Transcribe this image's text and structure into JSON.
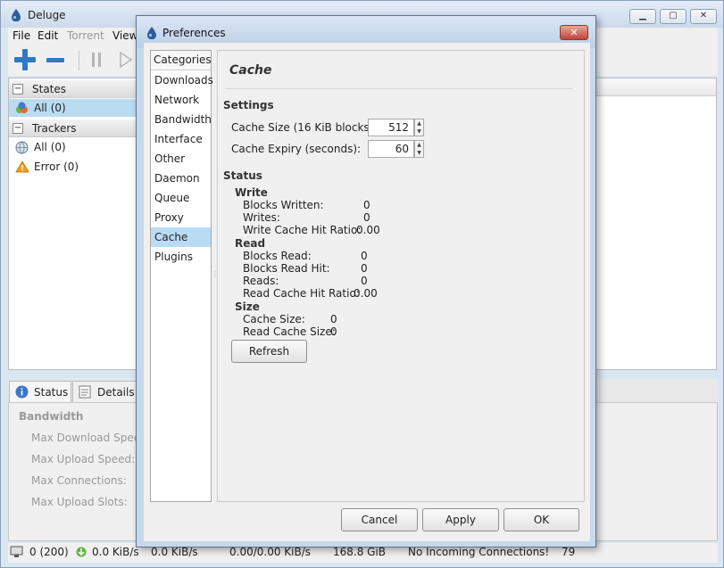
{
  "main": {
    "title": "Deluge",
    "menu": [
      "File",
      "Edit",
      "Torrent",
      "View"
    ],
    "sidebar": {
      "states_header": "States",
      "states_all": "All (0)",
      "trackers_header": "Trackers",
      "trackers_all": "All (0)",
      "trackers_error": "Error (0)"
    },
    "tabs": {
      "status": "Status",
      "details": "Details"
    },
    "bandwidth": {
      "header": "Bandwidth",
      "max_download": "Max Download Speed",
      "max_upload": "Max Upload Speed:",
      "max_connections": "Max Connections:",
      "max_upload_slots": "Max Upload Slots:"
    },
    "statusbar": {
      "connections": "0 (200)",
      "download": "0.0 KiB/s",
      "upload": "0.0 KiB/s",
      "protocol": "0.00/0.00 KiB/s",
      "disk": "168.8 GiB",
      "incoming": "No Incoming Connections!",
      "dht": "79"
    }
  },
  "dialog": {
    "title": "Preferences",
    "close": "✕",
    "categories_header": "Categories",
    "categories": [
      "Downloads",
      "Network",
      "Bandwidth",
      "Interface",
      "Other",
      "Daemon",
      "Queue",
      "Proxy",
      "Cache",
      "Plugins"
    ],
    "selected_category": "Cache",
    "page_title": "Cache",
    "settings": {
      "header": "Settings",
      "cache_size_label": "Cache Size (16 KiB blocks):",
      "cache_size_value": "512",
      "cache_expiry_label": "Cache Expiry (seconds):",
      "cache_expiry_value": "60"
    },
    "status": {
      "header": "Status",
      "write": {
        "header": "Write",
        "blocks_written_label": "Blocks Written:",
        "blocks_written": "0",
        "writes_label": "Writes:",
        "writes": "0",
        "hit_ratio_label": "Write Cache Hit Ratio:",
        "hit_ratio": "0.00"
      },
      "read": {
        "header": "Read",
        "blocks_read_label": "Blocks Read:",
        "blocks_read": "0",
        "blocks_read_hit_label": "Blocks Read Hit:",
        "blocks_read_hit": "0",
        "reads_label": "Reads:",
        "reads": "0",
        "hit_ratio_label": "Read Cache Hit Ratio:",
        "hit_ratio": "0.00"
      },
      "size": {
        "header": "Size",
        "cache_size_label": "Cache Size:",
        "cache_size": "0",
        "read_cache_size_label": "Read Cache Size:",
        "read_cache_size": "0"
      }
    },
    "buttons": {
      "refresh": "Refresh",
      "cancel": "Cancel",
      "apply": "Apply",
      "ok": "OK"
    }
  }
}
